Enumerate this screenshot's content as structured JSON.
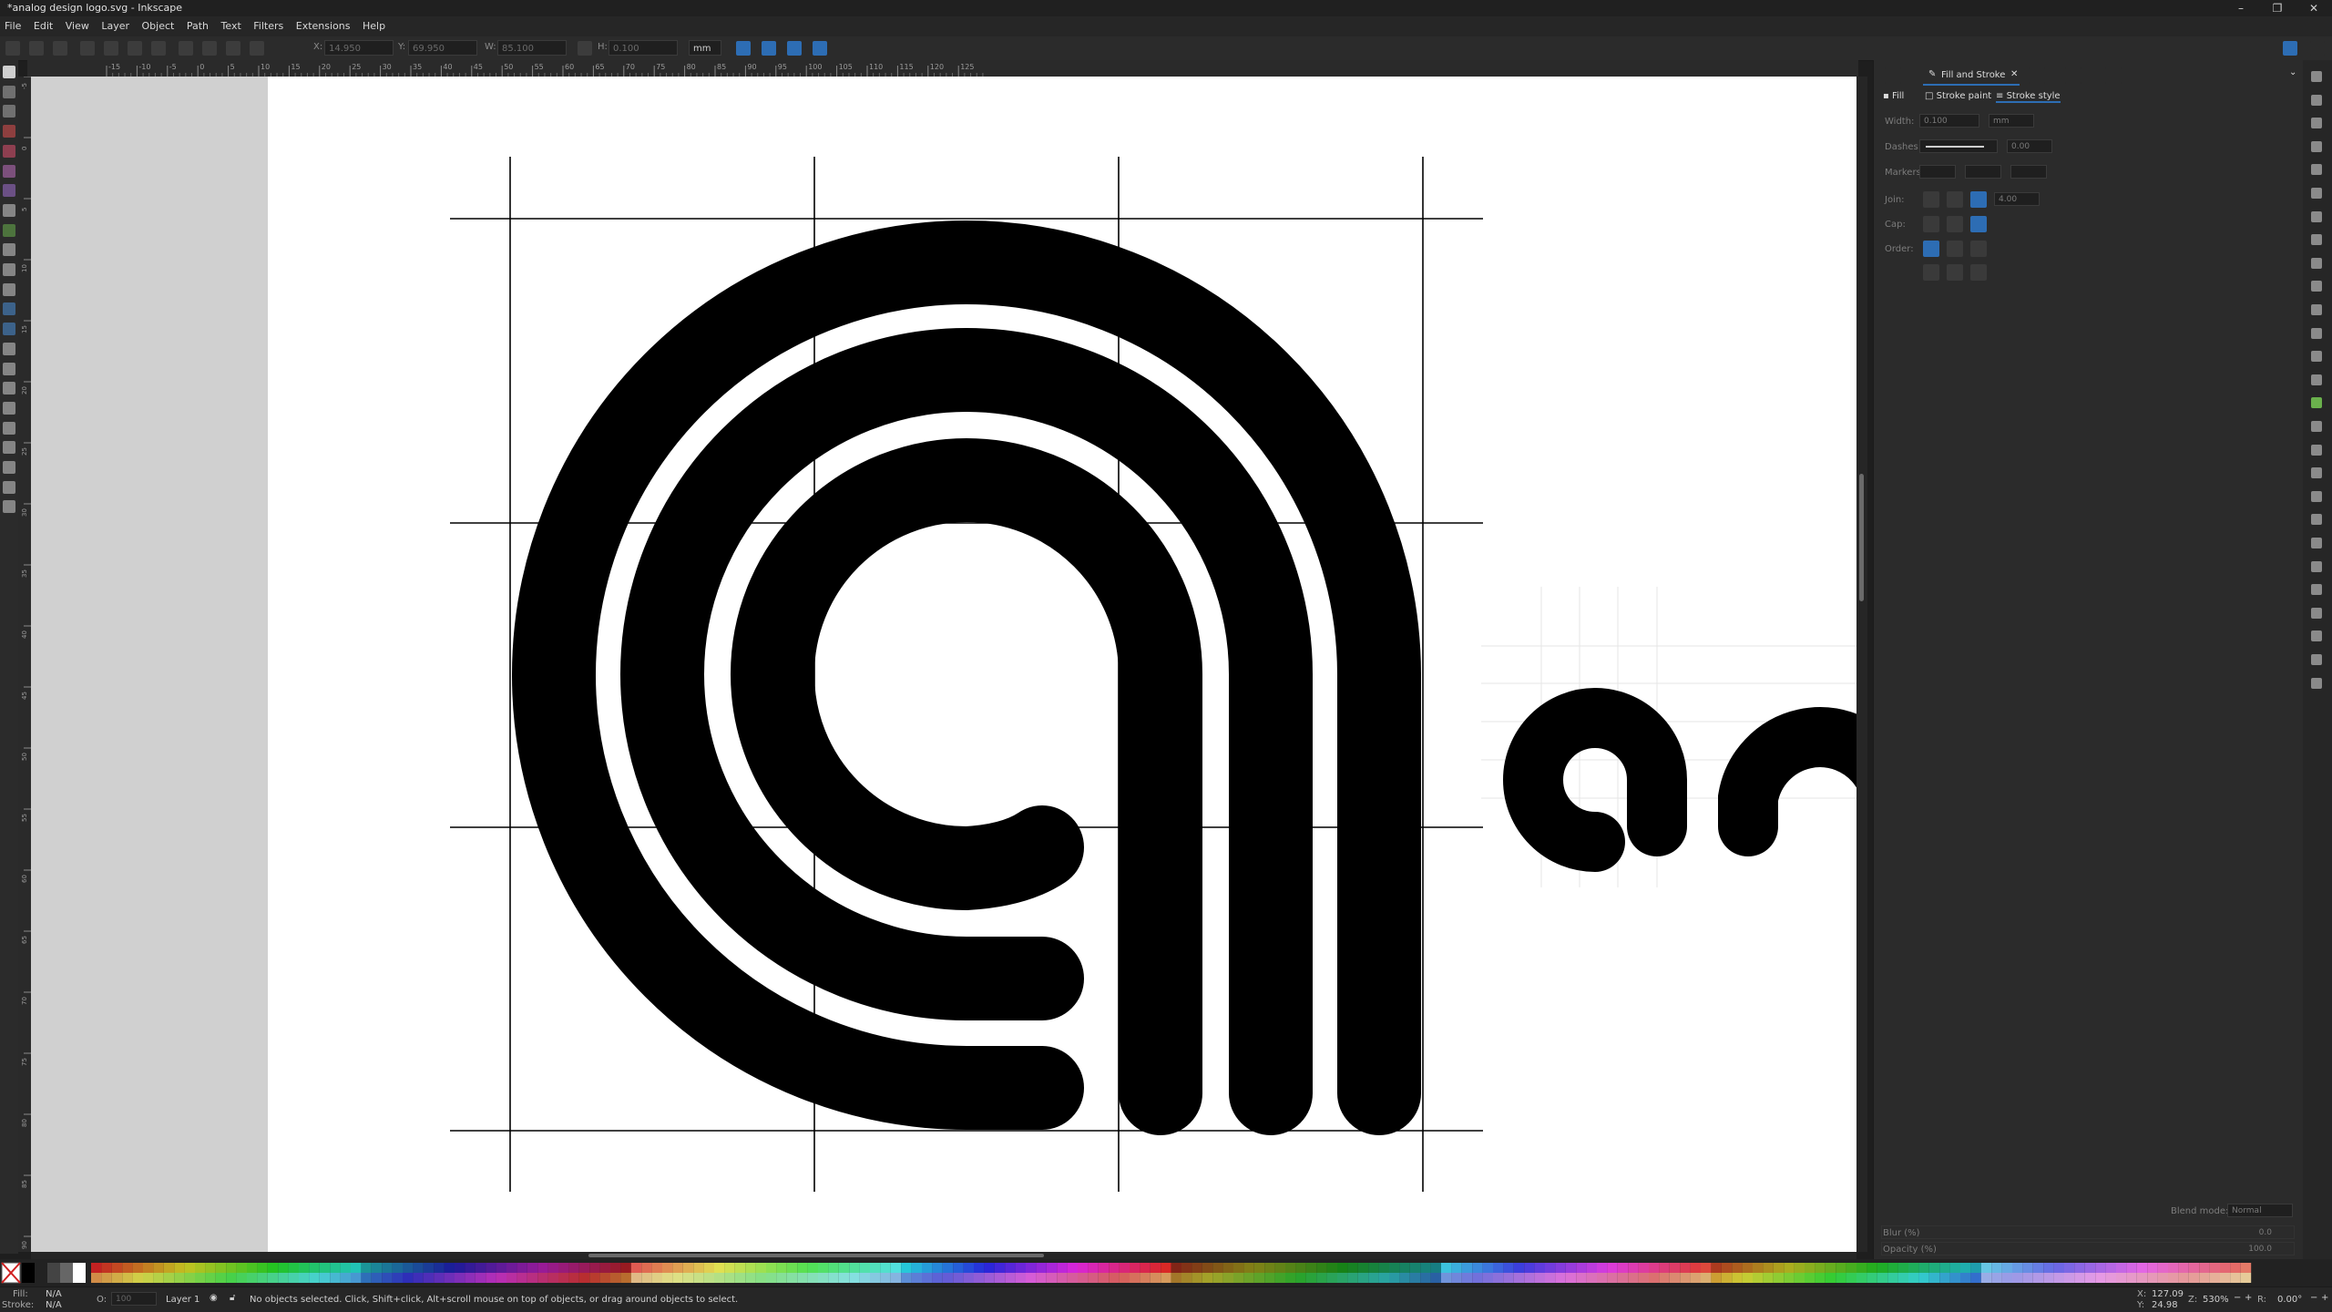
{
  "window": {
    "title": "*analog design logo.svg - Inkscape",
    "minimize": "–",
    "maximize": "❐",
    "close": "✕"
  },
  "menu": [
    "File",
    "Edit",
    "View",
    "Layer",
    "Object",
    "Path",
    "Text",
    "Filters",
    "Extensions",
    "Help"
  ],
  "toolbar": {
    "x_label": "X:",
    "x_value": "14.950",
    "y_label": "Y:",
    "y_value": "69.950",
    "w_label": "W:",
    "w_value": "85.100",
    "h_label": "H:",
    "h_value": "0.100",
    "unit": "mm"
  },
  "ruler": {
    "h_ticks": [
      "-15",
      "-10",
      "-5",
      "0",
      "5",
      "10",
      "15",
      "20",
      "25",
      "30",
      "35",
      "40",
      "45",
      "50",
      "55",
      "60",
      "65",
      "70",
      "75",
      "80",
      "85",
      "90",
      "95",
      "100",
      "105",
      "110",
      "115",
      "120",
      "125"
    ],
    "v_ticks": [
      "-5",
      "0",
      "5",
      "10",
      "15",
      "20",
      "25",
      "30",
      "35",
      "40",
      "45",
      "50",
      "55",
      "60",
      "65",
      "70",
      "75",
      "80",
      "85",
      "90",
      "95"
    ]
  },
  "panel": {
    "tab_label": "Fill and Stroke",
    "tab_close": "✕",
    "subtabs": {
      "fill": "Fill",
      "stroke_paint": "Stroke paint",
      "stroke_style": "Stroke style"
    },
    "width_label": "Width:",
    "width_value": "0.100",
    "width_unit": "mm",
    "dashes_label": "Dashes:",
    "dashes_value": "0.00",
    "markers_label": "Markers:",
    "join_label": "Join:",
    "join_value": "4.00",
    "cap_label": "Cap:",
    "order_label": "Order:",
    "blend_label": "Blend mode:",
    "blend_value": "Normal",
    "blur_label": "Blur (%)",
    "blur_value": "0.0",
    "opacity_label": "Opacity (%)",
    "opacity_value": "100.0"
  },
  "status": {
    "fill_label": "Fill:",
    "fill_value": "N/A",
    "stroke_label": "Stroke:",
    "stroke_value": "N/A",
    "o_label": "O:",
    "o_value": "100",
    "layer": "Layer 1",
    "message": "No objects selected. Click, Shift+click, Alt+scroll mouse on top of objects, or drag around objects to select.",
    "x_label": "X:",
    "x_value": "127.09",
    "y_label": "Y:",
    "y_value": "24.98",
    "z_label": "Z:",
    "zoom": "530%",
    "r_label": "R:",
    "rotation": "0.00°"
  },
  "colors": {
    "accent": "#2d6db4",
    "canvas_bg": "#d0d0d0",
    "page_bg": "#ffffff",
    "ink": "#000000"
  }
}
